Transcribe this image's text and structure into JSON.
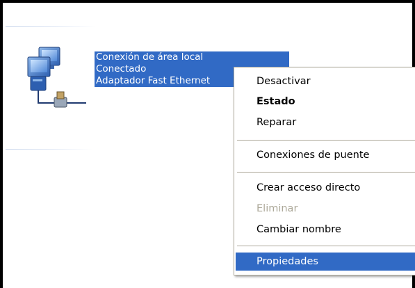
{
  "connection": {
    "name": "Conexión de área local",
    "status": "Conectado",
    "adapter": "Adaptador Fast Ethernet",
    "icon": "network-connection-icon"
  },
  "context_menu": {
    "items": [
      {
        "label": "Desactivar",
        "bold": false,
        "disabled": false,
        "selected": false
      },
      {
        "label": "Estado",
        "bold": true,
        "disabled": false,
        "selected": false
      },
      {
        "label": "Reparar",
        "bold": false,
        "disabled": false,
        "selected": false
      },
      {
        "label": "Conexiones de puente",
        "bold": false,
        "disabled": false,
        "selected": false
      },
      {
        "label": "Crear acceso directo",
        "bold": false,
        "disabled": false,
        "selected": false
      },
      {
        "label": "Eliminar",
        "bold": false,
        "disabled": true,
        "selected": false
      },
      {
        "label": "Cambiar nombre",
        "bold": false,
        "disabled": false,
        "selected": false
      },
      {
        "label": "Propiedades",
        "bold": false,
        "disabled": false,
        "selected": true
      }
    ]
  },
  "colors": {
    "selection": "#316ac5",
    "disabled_text": "#aca899",
    "frame_border": "#000000"
  }
}
